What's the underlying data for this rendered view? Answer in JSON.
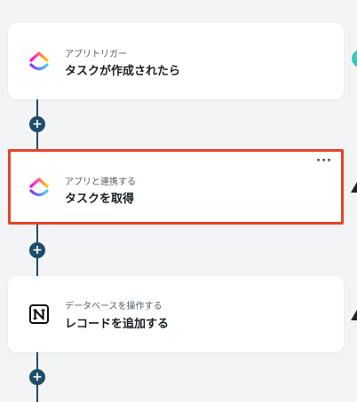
{
  "steps": [
    {
      "subtitle": "アプリトリガー",
      "title": "タスクが作成されたら",
      "app_icon": "clickup-icon"
    },
    {
      "subtitle": "アプリと連携する",
      "title": "タスクを取得",
      "app_icon": "clickup-icon",
      "more_label": "···"
    },
    {
      "subtitle": "データベースを操作する",
      "title": "レコードを追加する",
      "app_icon": "notion-icon"
    }
  ],
  "add_step_label": "+",
  "colors": {
    "connector": "#1e4d68",
    "selected_border": "#e8432a",
    "edge_circle": "#3fc7b8"
  }
}
